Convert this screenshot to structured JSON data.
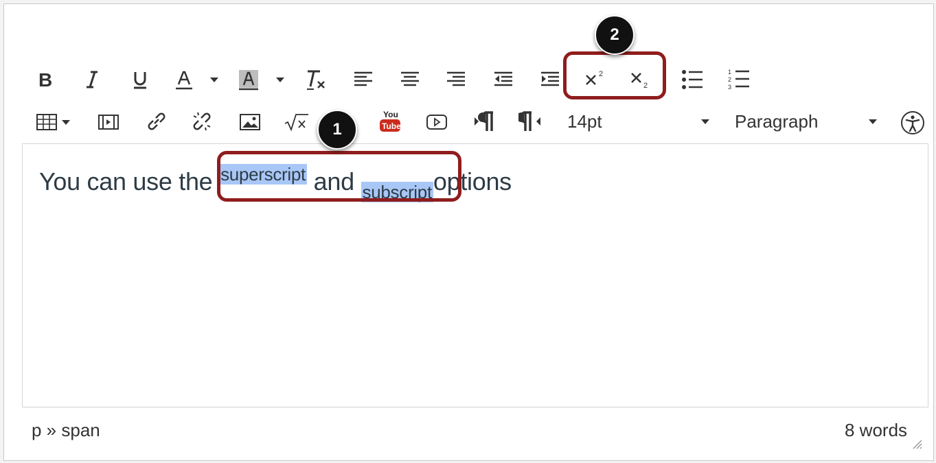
{
  "toolbar": {
    "font_size": "14pt",
    "block_format": "Paragraph",
    "youtube_top": "You",
    "youtube_bottom": "Tube"
  },
  "editor": {
    "text_before": "You can use the",
    "superscript": "superscript",
    "text_middle": "and",
    "subscript": "subscript",
    "text_after": "options"
  },
  "status": {
    "path": "p » span",
    "word_count": "8 words"
  },
  "callouts": {
    "one": "1",
    "two": "2"
  },
  "colors": {
    "callout": "#8f1d1d",
    "highlight": "#a8c7f7",
    "youtube": "#cc2b1d"
  },
  "icons": [
    "bold-icon",
    "italic-icon",
    "underline-icon",
    "text-color-icon",
    "background-color-icon",
    "clear-formatting-icon",
    "align-left-icon",
    "align-center-icon",
    "align-right-icon",
    "outdent-icon",
    "indent-icon",
    "superscript-icon",
    "subscript-icon",
    "bullet-list-icon",
    "numbered-list-icon",
    "table-icon",
    "media-icon",
    "link-icon",
    "unlink-icon",
    "image-icon",
    "math-icon",
    "youtube-icon",
    "embed-icon",
    "ltr-icon",
    "rtl-icon",
    "accessibility-icon"
  ]
}
